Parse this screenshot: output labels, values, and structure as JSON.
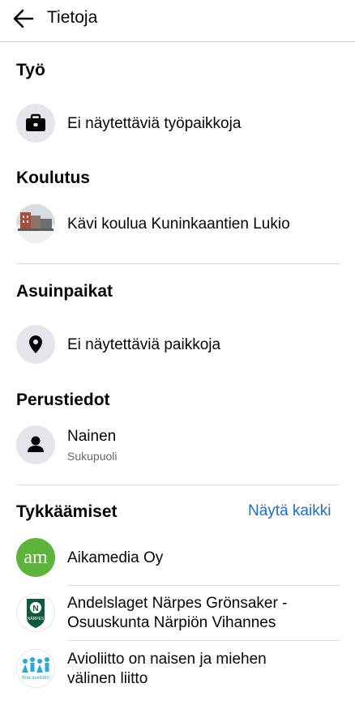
{
  "header": {
    "title": "Tietoja",
    "back_icon": "arrow-left-icon"
  },
  "work": {
    "title": "Työ",
    "item": "Ei näytettäviä työpaikkoja",
    "icon": "briefcase-icon"
  },
  "education": {
    "title": "Koulutus",
    "item": "Kävi koulua Kuninkaantien Lukio"
  },
  "places": {
    "title": "Asuinpaikat",
    "item": "Ei näytettäviä paikkoja",
    "icon": "location-pin-icon"
  },
  "basic": {
    "title": "Perustiedot",
    "item": "Nainen",
    "sub": "Sukupuoli",
    "icon": "person-icon"
  },
  "likes": {
    "title": "Tykkäämiset",
    "see_all": "Näytä kaikki",
    "items": [
      {
        "line1": "Aikamedia Oy",
        "logo_text": "am",
        "logo_color": "#5cb33a"
      },
      {
        "line1": "Andelslaget Närpes Grönsaker -",
        "line2": "Osuuskunta Närpiön Vihannes",
        "logo_text": "NÄRPES",
        "logo_color": "#0e5a3a"
      },
      {
        "line1": "Avioliitto on naisen ja miehen",
        "line2": "välinen liitto",
        "logo_text": "Kita avioliitto",
        "logo_color": "#2aa8d8"
      }
    ]
  },
  "colors": {
    "link": "#1b6fc9",
    "icon_bg": "#e4e6eb",
    "divider": "#dadde1"
  }
}
